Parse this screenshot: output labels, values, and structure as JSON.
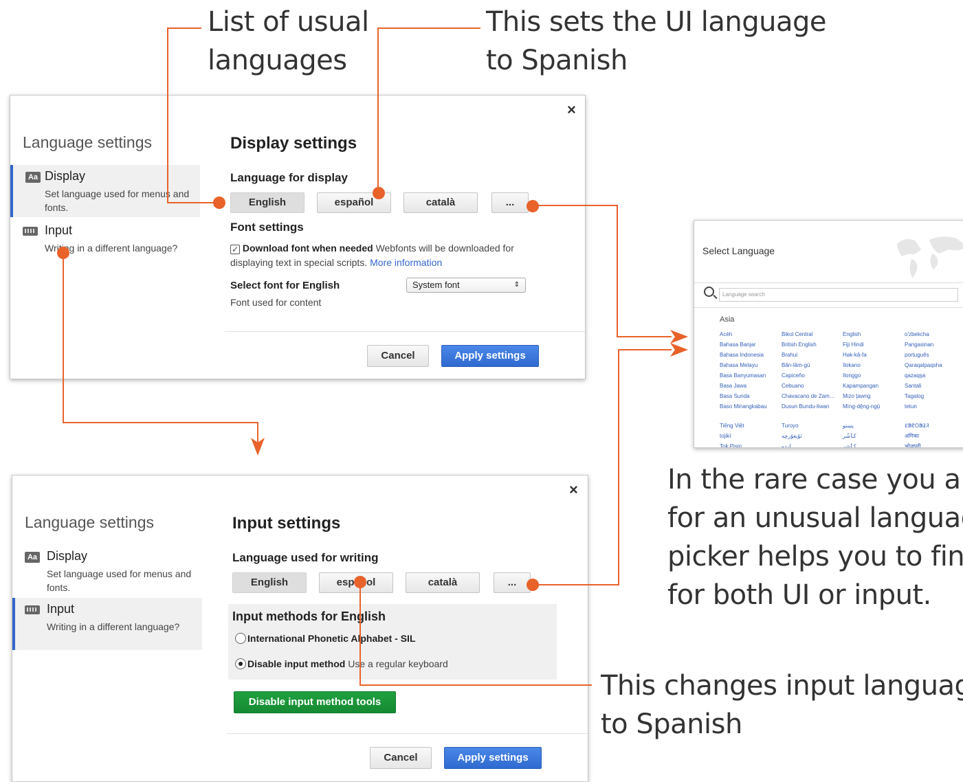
{
  "annotations": {
    "usual_languages": "List of usual\nlanguages",
    "ui_spanish": "This sets the UI language\nto Spanish",
    "rare_case": "In the rare case you are\nfor an unusual languag\npicker helps you to finc\nfor both UI or input.",
    "input_spanish": "This changes input language\nto Spanish"
  },
  "display_dialog": {
    "close": "×",
    "sidebar_title": "Language settings",
    "nav": [
      {
        "label": "Display",
        "sub": "Set language used for menus and fonts."
      },
      {
        "label": "Input",
        "sub": "Writing in a different language?"
      }
    ],
    "title": "Display settings",
    "language_heading": "Language for display",
    "language_buttons": [
      "English",
      "español",
      "català",
      "..."
    ],
    "font_heading": "Font settings",
    "download_font_label": "Download font when needed",
    "download_font_desc": "Webfonts will be downloaded for displaying text in special scripts.",
    "more_information": "More information",
    "select_font_label": "Select font for English",
    "font_select_value": "System font",
    "font_used": "Font used for content",
    "cancel": "Cancel",
    "apply": "Apply settings"
  },
  "input_dialog": {
    "close": "×",
    "sidebar_title": "Language settings",
    "nav": [
      {
        "label": "Display",
        "sub": "Set language used for menus and fonts."
      },
      {
        "label": "Input",
        "sub": "Writing in a different language?"
      }
    ],
    "title": "Input settings",
    "language_heading": "Language used for writing",
    "language_buttons": [
      "English",
      "español",
      "català",
      "..."
    ],
    "methods_heading": "Input methods for English",
    "method_ipa": "International Phonetic Alphabet - SIL",
    "method_disable_label": "Disable input method",
    "method_disable_desc": "Use a regular keyboard",
    "disable_tools": "Disable input method tools",
    "cancel": "Cancel",
    "apply": "Apply settings"
  },
  "select_language": {
    "title": "Select Language",
    "search_placeholder": "Language search",
    "region": "Asia",
    "columns": [
      [
        "Acèh",
        "Bahasa Banjar",
        "Bahasa Indonesia",
        "Bahasa Melayu",
        "Basa Banyumasan",
        "Basa Jawa",
        "Basa Sunda",
        "Baso Minangkabau"
      ],
      [
        "Bikol Central",
        "British English",
        "Brahui",
        "Bân-lâm-gú",
        "Capiceño",
        "Cebuano",
        "Chavacano de Zam…",
        "Dusun Bundu-liwan"
      ],
      [
        "English",
        "Fiji Hindi",
        "Hak-kâ-fa",
        "Ilokano",
        "Ilonggo",
        "Kapampangan",
        "Mizo ţawng",
        "Mìng-dĕ̤ng-ngṳ̄"
      ],
      [
        "o'zbekcha",
        "Pangasinan",
        "português",
        "Qaraqalpaqsha",
        "qazaqşa",
        "Santali",
        "Tagalog",
        "tetun"
      ]
    ],
    "columns_b": [
      [
        "Tiếng Việt",
        "tojikī",
        "Tok Pisin"
      ],
      [
        "Turoyo",
        "ئۇيغۇرچە",
        "اردو"
      ],
      [
        "پښتو",
        "کٲشُر",
        "کٲشر"
      ],
      [
        "ᱥᱟᱱᱛᱟᱲᱤ",
        "अंगिका",
        "भोजपुरी"
      ]
    ]
  }
}
